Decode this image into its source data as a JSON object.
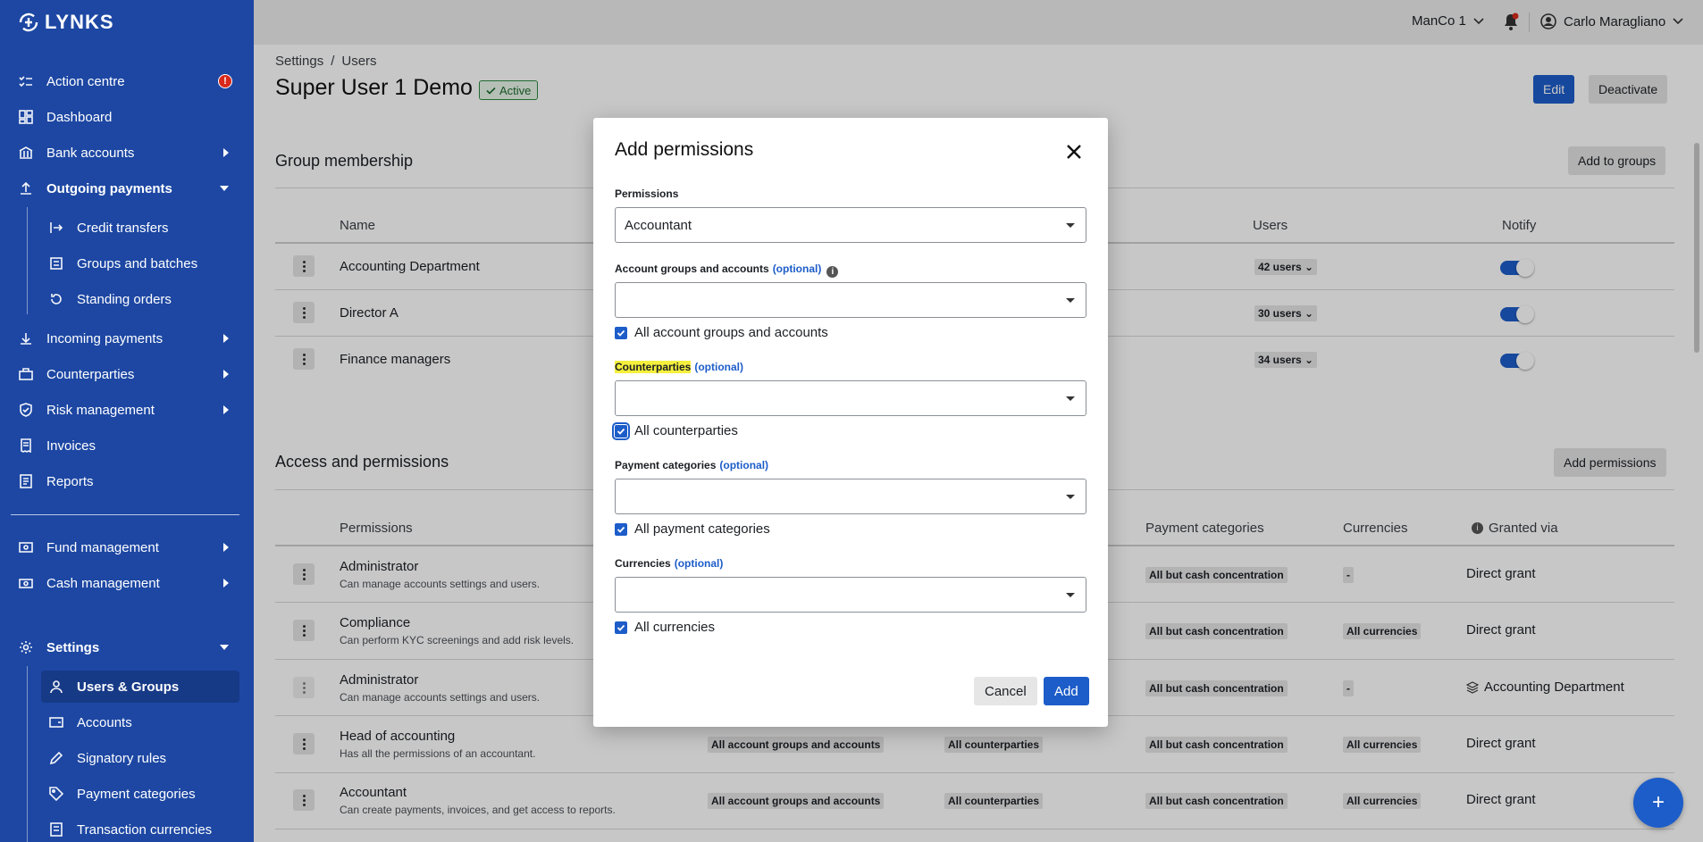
{
  "brand": {
    "name": "LYNKS"
  },
  "sidebar": {
    "items": [
      {
        "label": "Action centre",
        "icon": "tasks-icon",
        "alert": "!"
      },
      {
        "label": "Dashboard",
        "icon": "dashboard-icon"
      },
      {
        "label": "Bank accounts",
        "icon": "bank-icon"
      },
      {
        "label": "Outgoing payments",
        "icon": "upload-icon"
      },
      {
        "label": "Credit transfers",
        "icon": "transfer-icon"
      },
      {
        "label": "Groups and batches",
        "icon": "batch-icon"
      },
      {
        "label": "Standing orders",
        "icon": "repeat-icon"
      },
      {
        "label": "Incoming payments",
        "icon": "download-icon"
      },
      {
        "label": "Counterparties",
        "icon": "counterparties-icon"
      },
      {
        "label": "Risk management",
        "icon": "shield-icon"
      },
      {
        "label": "Invoices",
        "icon": "invoice-icon"
      },
      {
        "label": "Reports",
        "icon": "report-icon"
      },
      {
        "label": "Fund management",
        "icon": "fund-icon"
      },
      {
        "label": "Cash management",
        "icon": "cash-icon"
      },
      {
        "label": "Settings",
        "icon": "gear-icon"
      },
      {
        "label": "Users & Groups",
        "icon": "users-icon"
      },
      {
        "label": "Accounts",
        "icon": "wallet-icon"
      },
      {
        "label": "Signatory rules",
        "icon": "pen-icon"
      },
      {
        "label": "Payment categories",
        "icon": "tag-icon"
      },
      {
        "label": "Transaction currencies",
        "icon": "currency-icon"
      }
    ]
  },
  "topbar": {
    "org": "ManCo 1",
    "user": "Carlo Maragliano"
  },
  "breadcrumb": {
    "root": "Settings",
    "sep": "/",
    "current": "Users"
  },
  "page": {
    "title": "Super User 1 Demo",
    "status": "Active",
    "edit": "Edit",
    "deactivate": "Deactivate"
  },
  "groups": {
    "title": "Group membership",
    "add_button": "Add to groups",
    "columns": {
      "name": "Name",
      "users": "Users",
      "notify": "Notify"
    },
    "rows": [
      {
        "name": "Accounting Department",
        "users": "42 users"
      },
      {
        "name": "Director A",
        "users": "30 users"
      },
      {
        "name": "Finance managers",
        "users": "34 users"
      }
    ]
  },
  "access": {
    "title": "Access and permissions",
    "add_button": "Add permissions",
    "columns": {
      "permissions": "Permissions",
      "payment_categories": "Payment categories",
      "currencies": "Currencies",
      "granted_via": "Granted via"
    },
    "rows": [
      {
        "name": "Administrator",
        "desc": "Can manage accounts settings and users.",
        "accounts": "",
        "counterparties": "",
        "pay_cat": "All but cash concentration",
        "currencies": "-",
        "granted": "Direct grant"
      },
      {
        "name": "Compliance",
        "desc": "Can perform KYC screenings and add risk levels.",
        "accounts": "",
        "counterparties": "",
        "pay_cat": "All but cash concentration",
        "currencies": "All currencies",
        "granted": "Direct grant"
      },
      {
        "name": "Administrator",
        "desc": "Can manage accounts settings and users.",
        "accounts": "",
        "counterparties": "",
        "pay_cat": "All but cash concentration",
        "currencies": "-",
        "granted": "Accounting Department"
      },
      {
        "name": "Head of accounting",
        "desc": "Has all the permissions of an accountant.",
        "accounts": "All account groups and accounts",
        "counterparties": "All counterparties",
        "pay_cat": "All but cash concentration",
        "currencies": "All currencies",
        "granted": "Direct grant"
      },
      {
        "name": "Accountant",
        "desc": "Can create payments, invoices, and get access to reports.",
        "accounts": "All account groups and accounts",
        "counterparties": "All counterparties",
        "pay_cat": "All but cash concentration",
        "currencies": "All currencies",
        "granted": "Direct grant"
      }
    ]
  },
  "modal": {
    "title": "Add permissions",
    "permissions_label": "Permissions",
    "permissions_value": "Accountant",
    "accounts_label": "Account groups and accounts",
    "optional": "(optional)",
    "accounts_check": "All account groups and accounts",
    "counterparties_label": "Counterparties",
    "counterparties_check": "All counterparties",
    "paycat_label": "Payment categories",
    "paycat_check": "All payment categories",
    "currencies_label": "Currencies",
    "currencies_check": "All currencies",
    "cancel": "Cancel",
    "add": "Add"
  },
  "fab": {
    "label": "+"
  },
  "colors": {
    "sidebar": "#1d47a3",
    "primary": "#1d5dc9",
    "highlight": "#f5f03d"
  }
}
